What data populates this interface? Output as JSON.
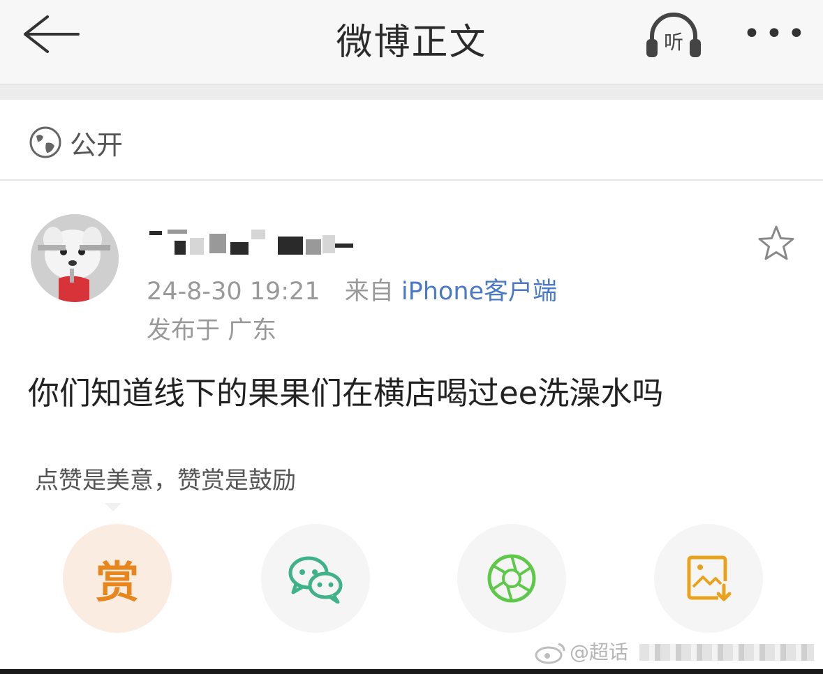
{
  "header": {
    "title": "微博正文",
    "listen_label": "听",
    "more_label": "•••"
  },
  "visibility": {
    "label": "公开"
  },
  "post": {
    "time": "24-8-30 19:21",
    "source_prefix": "来自",
    "source_link": "iPhone客户端",
    "location": "发布于 广东",
    "content": "你们知道线下的果果们在横店喝过ee洗澡水吗"
  },
  "actions": {
    "reward_tip": "点赞是美意，赞赏是鼓励",
    "reward_label": "赏"
  },
  "watermark": {
    "text": "@超话"
  },
  "colors": {
    "link": "#4a7ac6",
    "reward": "#e8861e",
    "wechat": "#3fb28a",
    "moments": "#5fc84a",
    "save": "#e8a21e"
  }
}
